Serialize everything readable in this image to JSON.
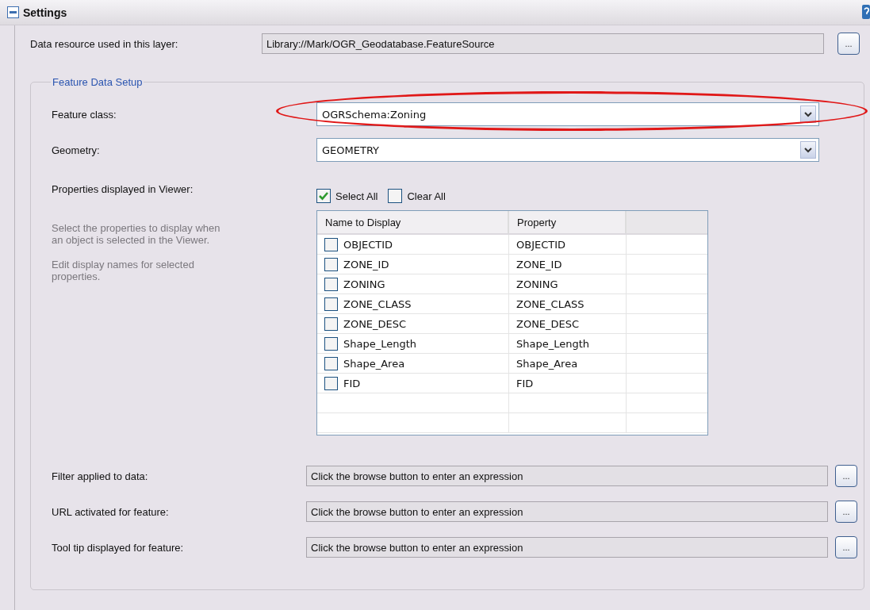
{
  "header": {
    "title": "Settings"
  },
  "data_resource": {
    "label": "Data resource used in this layer:",
    "value": "Library://Mark/OGR_Geodatabase.FeatureSource",
    "button": "..."
  },
  "group": {
    "title": "Feature Data Setup",
    "feature_class": {
      "label": "Feature class:",
      "value": "OGRSchema:Zoning"
    },
    "geometry": {
      "label": "Geometry:",
      "value": "GEOMETRY"
    },
    "properties": {
      "label": "Properties displayed in Viewer:",
      "hints": [
        "Select the properties to display when an object is selected in the Viewer.",
        "Edit display names for selected properties."
      ],
      "select_all": {
        "label": "Select All",
        "checked": true
      },
      "clear_all": {
        "label": "Clear All",
        "checked": false
      },
      "table": {
        "columns": [
          "Name to Display",
          "Property"
        ],
        "rows": [
          {
            "name": "OBJECTID",
            "property": "OBJECTID",
            "checked": false
          },
          {
            "name": "ZONE_ID",
            "property": "ZONE_ID",
            "checked": false
          },
          {
            "name": "ZONING",
            "property": "ZONING",
            "checked": false
          },
          {
            "name": "ZONE_CLASS",
            "property": "ZONE_CLASS",
            "checked": false
          },
          {
            "name": "ZONE_DESC",
            "property": "ZONE_DESC",
            "checked": false
          },
          {
            "name": "Shape_Length",
            "property": "Shape_Length",
            "checked": false
          },
          {
            "name": "Shape_Area",
            "property": "Shape_Area",
            "checked": false
          },
          {
            "name": "FID",
            "property": "FID",
            "checked": false
          }
        ]
      }
    },
    "expressions": [
      {
        "label": "Filter applied to data:",
        "value": "Click the browse button to enter an expression",
        "button": "..."
      },
      {
        "label": "URL activated for feature:",
        "value": "Click the browse button to enter an expression",
        "button": "..."
      },
      {
        "label": "Tool tip displayed for feature:",
        "value": "Click the browse button to enter an expression",
        "button": "..."
      }
    ]
  }
}
